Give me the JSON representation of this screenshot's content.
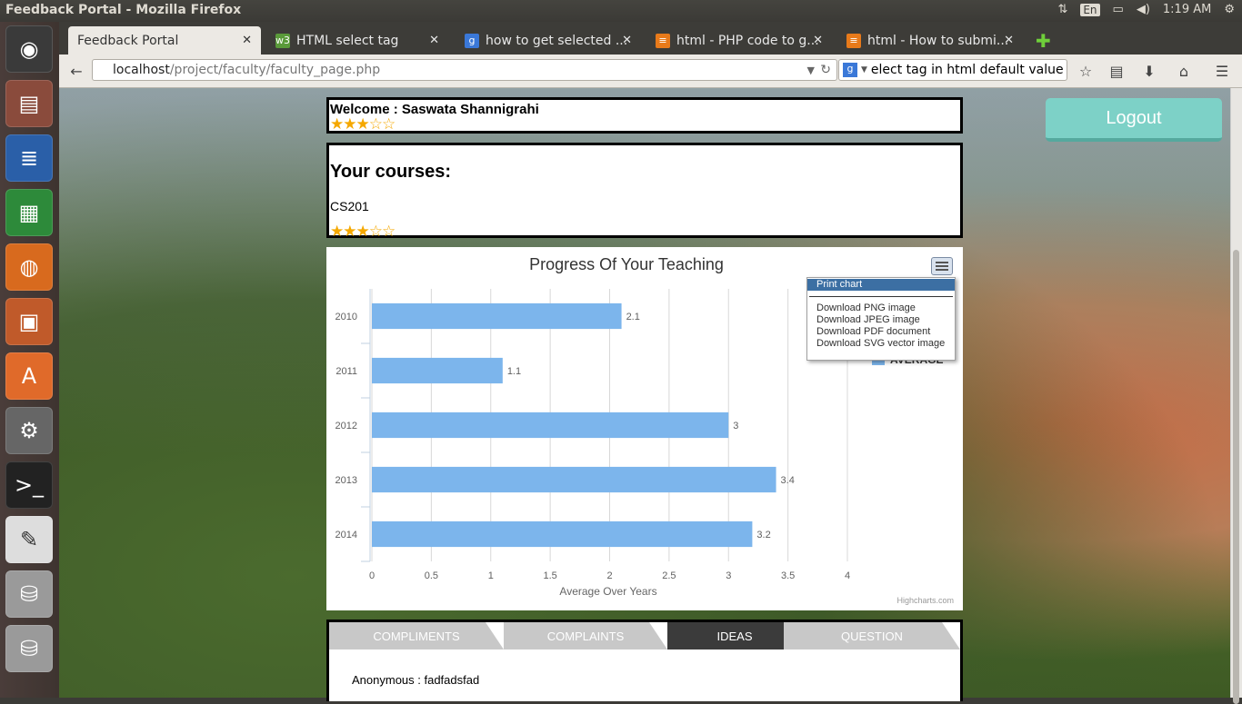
{
  "os": {
    "window_title": "Feedback Portal - Mozilla Firefox",
    "tray": {
      "lang": "En",
      "time": "1:19 AM"
    },
    "launcher_icons": [
      "ubuntu-logo-icon",
      "files-icon",
      "writer-icon",
      "calc-icon",
      "firefox-icon",
      "impress-icon",
      "software-center-icon",
      "settings-icon",
      "terminal-icon",
      "text-editor-icon",
      "drive-icon",
      "drive-icon",
      "trash-icon"
    ]
  },
  "browser": {
    "tabs": [
      {
        "label": "Feedback Portal",
        "active": true
      },
      {
        "label": "HTML select tag",
        "active": false
      },
      {
        "label": "how to get selected ...",
        "active": false
      },
      {
        "label": "html - PHP code to g...",
        "active": false
      },
      {
        "label": "html - How to submi...",
        "active": false
      }
    ],
    "url_host": "localhost",
    "url_path": "/project/faculty/faculty_page.php",
    "search_text": "elect tag in html default value"
  },
  "page": {
    "welcome_label": "Welcome : Saswata Shannigrahi",
    "welcome_rating": 3,
    "courses_heading": "Your courses:",
    "course_code": "CS201",
    "course_rating": 3,
    "logout_label": "Logout",
    "feedback_tabs": [
      "COMPLIMENTS",
      "COMPLAINTS",
      "IDEAS",
      "QUESTION"
    ],
    "active_feedback_tab": "IDEAS",
    "post_text": "Anonymous : fadfadsfad"
  },
  "chart_data": {
    "type": "bar",
    "orientation": "horizontal",
    "title": "Progress Of Your Teaching",
    "categories": [
      "2010",
      "2011",
      "2012",
      "2013",
      "2014"
    ],
    "series": [
      {
        "name": "AVERAGE",
        "values": [
          2.1,
          1.1,
          3,
          3.4,
          3.2
        ],
        "color": "#7cb5ec"
      }
    ],
    "xlabel": "Average Over Years",
    "ylabel": "",
    "xlim": [
      0,
      4
    ],
    "ticks": [
      "0",
      "0.5",
      "1",
      "1.5",
      "2",
      "2.5",
      "3",
      "3.5",
      "4"
    ],
    "grid": true,
    "credits": "Highcharts.com"
  },
  "export_menu": {
    "items": [
      "Print chart",
      "Download PNG image",
      "Download JPEG image",
      "Download PDF document",
      "Download SVG vector image"
    ],
    "highlighted": "Print chart"
  }
}
